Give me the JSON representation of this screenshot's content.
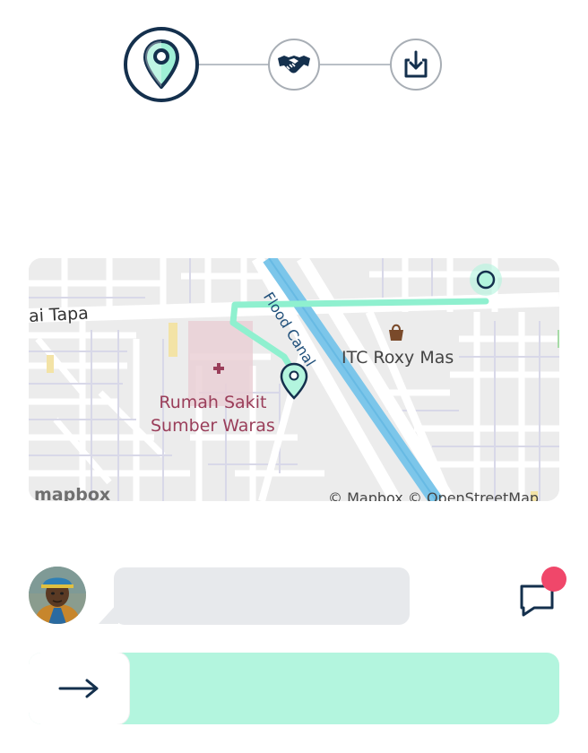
{
  "progress": {
    "steps": [
      {
        "icon": "location-pin-icon",
        "state": "active"
      },
      {
        "icon": "handshake-icon",
        "state": "pending"
      },
      {
        "icon": "download-icon",
        "state": "pending"
      }
    ],
    "active_color": "#14304d",
    "inactive_color": "#a8aeb5"
  },
  "map": {
    "labels": {
      "street": "ai Tapa",
      "canal": "Flood Canal",
      "mall": "ITC Roxy Mas",
      "hospital_line1": "Rumah Sakit",
      "hospital_line2": "Sumber Waras",
      "logo": "mapbox",
      "attribution": "© Mapbox © OpenStreetMap"
    },
    "route_color": "#8ff0cf",
    "canal_color": "#7cc6ea"
  },
  "chat": {
    "message": "",
    "has_unread": true,
    "unread_color": "#f0476a"
  },
  "slider": {
    "label": "",
    "color": "#b3f5de",
    "handle_icon": "arrow-right-icon"
  }
}
